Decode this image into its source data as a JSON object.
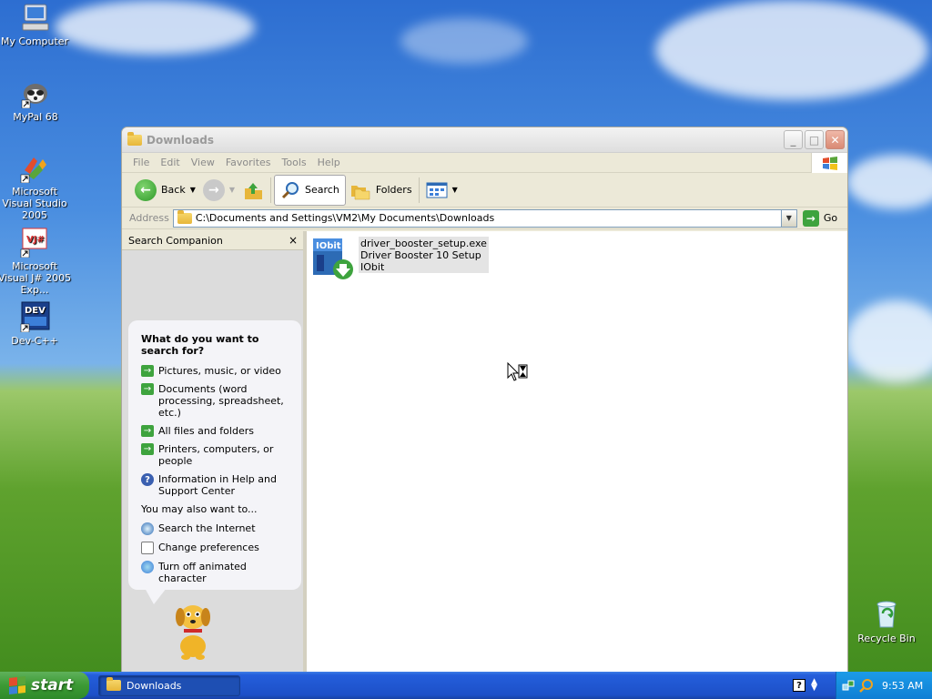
{
  "desktop": {
    "icons": [
      {
        "label": "My Computer"
      },
      {
        "label": "MyPal 68"
      },
      {
        "label": "Microsoft Visual Studio 2005"
      },
      {
        "label": "Microsoft Visual J# 2005 Exp..."
      },
      {
        "label": "Dev-C++"
      },
      {
        "label": "Recycle Bin"
      }
    ]
  },
  "window": {
    "title": "Downloads",
    "menu": [
      "File",
      "Edit",
      "View",
      "Favorites",
      "Tools",
      "Help"
    ],
    "toolbar": {
      "back": "Back",
      "search": "Search",
      "folders": "Folders"
    },
    "address": {
      "label": "Address",
      "value": "C:\\Documents and Settings\\VM2\\My Documents\\Downloads",
      "go": "Go"
    },
    "companion": {
      "header": "Search Companion",
      "close": "×",
      "question": "What do you want to search for?",
      "options": [
        "Pictures, music, or video",
        "Documents (word processing, spreadsheet, etc.)",
        "All files and folders",
        "Printers, computers, or people",
        "Information in Help and Support Center"
      ],
      "also_title": "You may also want to...",
      "also": [
        "Search the Internet",
        "Change preferences",
        "Turn off animated character"
      ]
    },
    "files": [
      {
        "name": "driver_booster_setup.exe",
        "description": "Driver Booster 10 Setup",
        "company": "IObit",
        "icon_text": "IObit"
      }
    ]
  },
  "taskbar": {
    "start": "start",
    "task_button": "Downloads",
    "clock": "9:53 AM"
  }
}
